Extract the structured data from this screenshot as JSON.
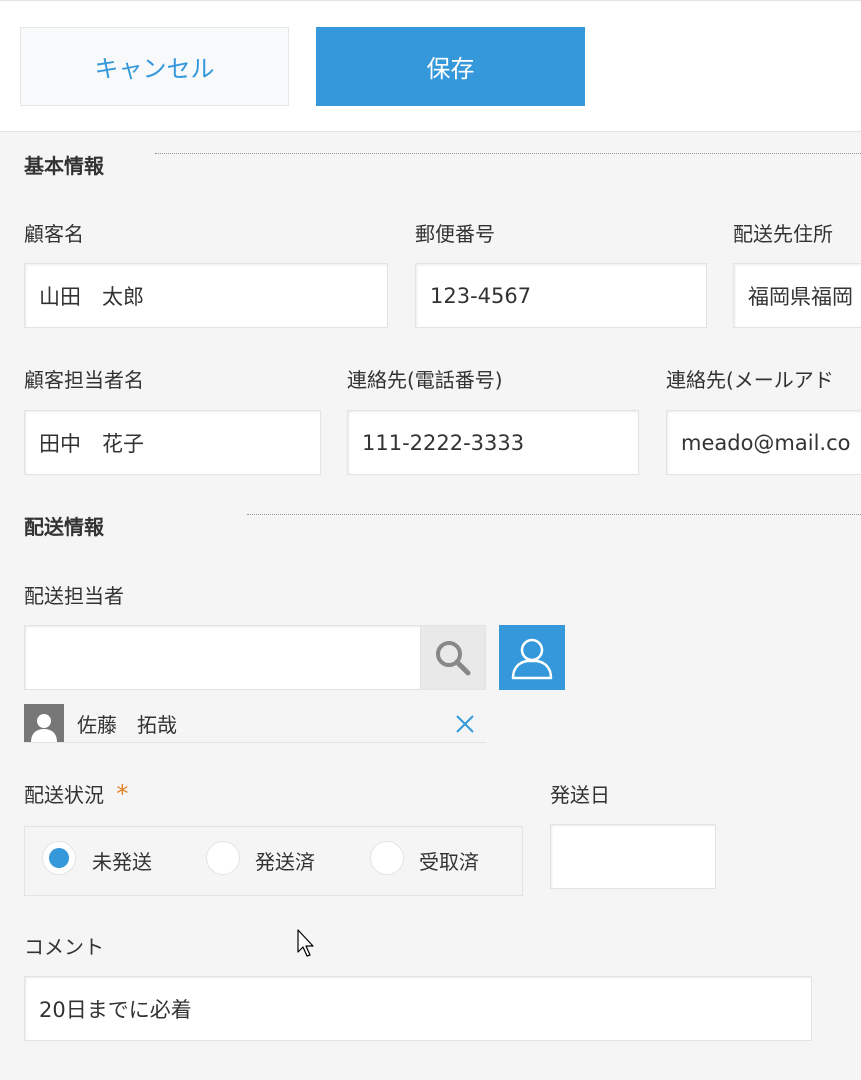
{
  "toolbar": {
    "cancel_label": "キャンセル",
    "save_label": "保存"
  },
  "basic_info": {
    "title": "基本情報",
    "customer_name": {
      "label": "顧客名",
      "value": "山田　太郎"
    },
    "postal_code": {
      "label": "郵便番号",
      "value": "123-4567"
    },
    "delivery_address": {
      "label": "配送先住所",
      "value": "福岡県福岡"
    },
    "contact_person": {
      "label": "顧客担当者名",
      "value": "田中　花子"
    },
    "phone": {
      "label": "連絡先(電話番号)",
      "value": "111-2222-3333"
    },
    "email": {
      "label": "連絡先(メールアド",
      "value": "meado@mail.co"
    }
  },
  "delivery_info": {
    "title": "配送情報",
    "assignee": {
      "label": "配送担当者",
      "search_value": "",
      "selected_user": "佐藤　拓哉"
    },
    "status": {
      "label": "配送状況",
      "required_mark": "*",
      "options": [
        "未発送",
        "発送済",
        "受取済"
      ],
      "selected": "未発送"
    },
    "ship_date": {
      "label": "発送日",
      "value": ""
    },
    "comment": {
      "label": "コメント",
      "value": "20日までに必着"
    }
  },
  "colors": {
    "accent": "#3498db",
    "required": "#e67e22",
    "background": "#f5f5f5"
  },
  "icons": [
    "search-icon",
    "user-select-icon",
    "user-avatar-icon",
    "remove-icon",
    "mouse-cursor-icon"
  ]
}
